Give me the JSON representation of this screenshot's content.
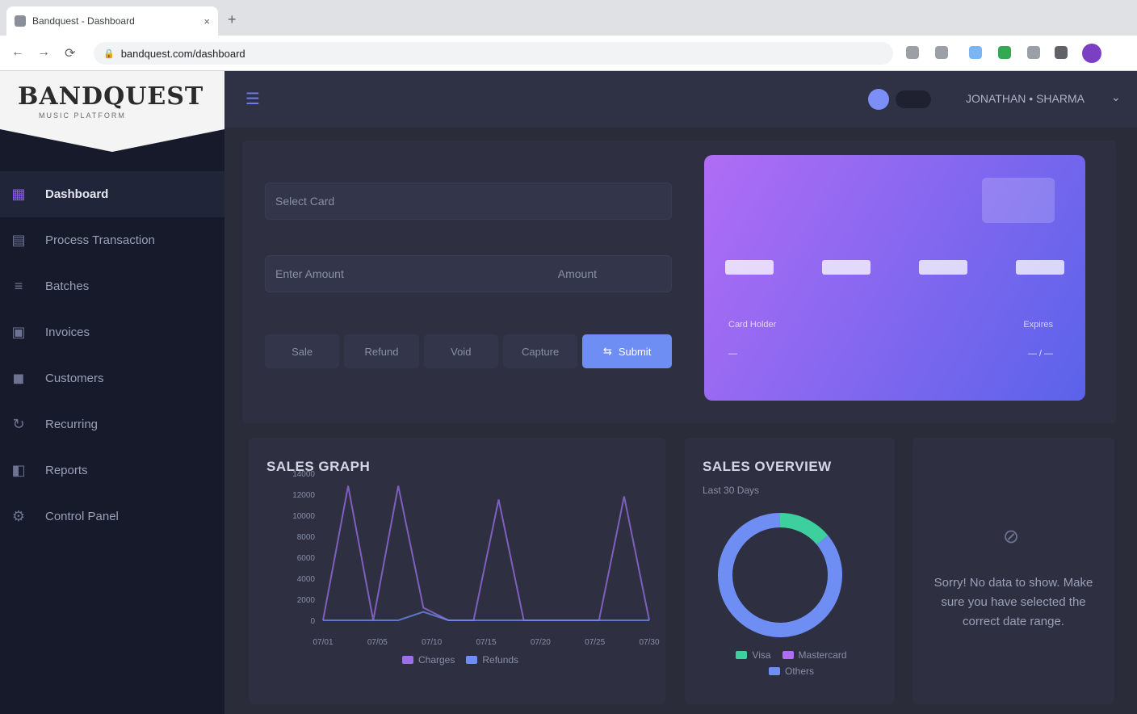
{
  "browser": {
    "tab_title": "Bandquest - Dashboard",
    "tab_close": "×",
    "new_tab": "+",
    "url": "bandquest.com/dashboard",
    "nav_back": "←",
    "nav_forward": "→",
    "nav_reload": "⟳",
    "ext_colors": [
      "#9aa0a6",
      "#9aa0a6",
      "#7cb6f2",
      "#34a853",
      "#9aa0a6",
      "#5f6368"
    ]
  },
  "sidebar": {
    "logo": "BANDQUEST",
    "logo_sub": "MUSIC PLATFORM",
    "items": [
      {
        "label": "Dashboard",
        "icon": "dashboard-icon",
        "glyph": "▦",
        "active": true
      },
      {
        "label": "Process Transaction",
        "icon": "transaction-icon",
        "glyph": "▤",
        "active": false
      },
      {
        "label": "Batches",
        "icon": "batches-icon",
        "glyph": "≡",
        "active": false
      },
      {
        "label": "Invoices",
        "icon": "invoice-icon",
        "glyph": "▣",
        "active": false
      },
      {
        "label": "Customers",
        "icon": "customers-icon",
        "glyph": "◼",
        "active": false
      },
      {
        "label": "Recurring",
        "icon": "recurring-icon",
        "glyph": "↻",
        "active": false
      },
      {
        "label": "Reports",
        "icon": "reports-icon",
        "glyph": "◧",
        "active": false
      },
      {
        "label": "Control Panel",
        "icon": "control-panel-icon",
        "glyph": "⚙",
        "active": false
      }
    ]
  },
  "topbar": {
    "menu_glyph": "☰",
    "user_name": "JONATHAN • SHARMA",
    "caret": "⌄"
  },
  "form": {
    "field1_placeholder": "Select Card",
    "field2_placeholder": "Enter Amount",
    "field2_suffix": "Amount",
    "buttons": [
      "Sale",
      "Refund",
      "Void",
      "Capture",
      "Submit"
    ],
    "submit_icon": "⇆"
  },
  "card": {
    "number_groups": [
      "••••",
      "••••",
      "••••",
      "••••"
    ],
    "holder_label": "Card Holder",
    "holder": "—",
    "expiry_label": "Expires",
    "expiry": "— / —",
    "gradient_start": "#b06cf5",
    "gradient_end": "#5a63ea"
  },
  "graph": {
    "title": "SALES GRAPH",
    "legend": [
      {
        "name": "Charges",
        "color": "#9b6fe8"
      },
      {
        "name": "Refunds",
        "color": "#6f8ef3"
      }
    ]
  },
  "donut": {
    "title": "SALES OVERVIEW",
    "subtitle": "Last 30 Days",
    "legend": [
      {
        "name": "Visa",
        "color": "#3ecf9e"
      },
      {
        "name": "Mastercard",
        "color": "#b06cf5"
      },
      {
        "name": "Others",
        "color": "#6f8ef3"
      }
    ]
  },
  "empty": {
    "icon_glyph": "⊘",
    "text": "Sorry! No data to show. Make sure you have selected the correct date range."
  },
  "chart_data": [
    {
      "type": "line",
      "title": "SALES GRAPH",
      "x": [
        "07/01",
        "07/05",
        "07/10",
        "07/15",
        "07/20",
        "07/25",
        "07/30"
      ],
      "ylim": [
        0,
        14000
      ],
      "yticks": [
        "0",
        "2000",
        "4000",
        "6000",
        "8000",
        "10000",
        "12000",
        "14000"
      ],
      "series": [
        {
          "name": "Charges",
          "color": "#9b6fe8",
          "values": [
            0,
            12800,
            0,
            12800,
            1200,
            0,
            0,
            11500,
            0,
            0,
            0,
            0,
            11800,
            0
          ]
        },
        {
          "name": "Refunds",
          "color": "#6f8ef3",
          "values": [
            0,
            0,
            0,
            0,
            800,
            0,
            0,
            0,
            0,
            0,
            0,
            0,
            0,
            0
          ]
        }
      ],
      "grid": false,
      "legend": "bottom"
    },
    {
      "type": "pie",
      "title": "SALES OVERVIEW",
      "labels": [
        "Visa",
        "Mastercard",
        "Others"
      ],
      "values": [
        14,
        0,
        86
      ]
    }
  ]
}
